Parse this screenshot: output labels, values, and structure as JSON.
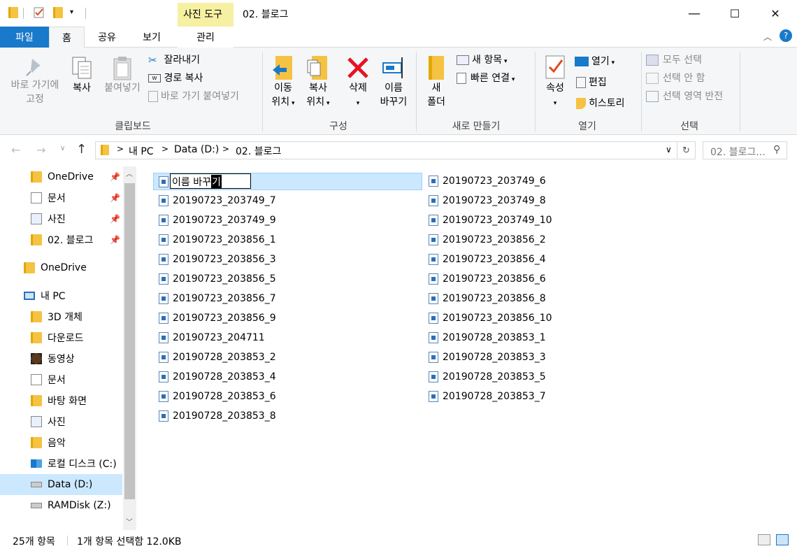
{
  "titlebar": {
    "tool_tab": "사진 도구",
    "window_title": "02. 블로그",
    "minimize": "—",
    "maximize": "☐",
    "close": "✕"
  },
  "tabs": {
    "file": "파일",
    "home": "홈",
    "share": "공유",
    "view": "보기",
    "manage": "관리"
  },
  "ribbon": {
    "clipboard": {
      "pin_line1": "바로 가기에",
      "pin_line2": "고정",
      "copy": "복사",
      "paste": "붙여넣기",
      "cut": "잘라내기",
      "copy_path": "경로 복사",
      "paste_shortcut": "바로 가기 붙여넣기",
      "group": "클립보드"
    },
    "organize": {
      "move_line1": "이동",
      "move_line2": "위치",
      "copyto_line1": "복사",
      "copyto_line2": "위치",
      "delete": "삭제",
      "rename_line1": "이름",
      "rename_line2": "바꾸기",
      "group": "구성"
    },
    "new": {
      "folder_line1": "새",
      "folder_line2": "폴더",
      "new_item": "새 항목",
      "easy_access": "빠른 연결",
      "group": "새로 만들기"
    },
    "open": {
      "properties": "속성",
      "open": "열기",
      "edit": "편집",
      "history": "히스토리",
      "group": "열기"
    },
    "select": {
      "select_all": "모두 선택",
      "select_none": "선택 안 함",
      "invert": "선택 영역 반전",
      "group": "선택"
    }
  },
  "address": {
    "crumbs": [
      "내 PC",
      "Data (D:)",
      "02. 블로그"
    ],
    "search_placeholder": "02. 블로그..."
  },
  "nav": {
    "quick": [
      {
        "label": "OneDrive"
      },
      {
        "label": "문서"
      },
      {
        "label": "사진"
      },
      {
        "label": "02. 블로그"
      }
    ],
    "onedrive": "OneDrive",
    "mypc": "내 PC",
    "pc_items": [
      {
        "label": "3D 개체"
      },
      {
        "label": "다운로드"
      },
      {
        "label": "동영상"
      },
      {
        "label": "문서"
      },
      {
        "label": "바탕 화면"
      },
      {
        "label": "사진"
      },
      {
        "label": "음악"
      },
      {
        "label": "로컬 디스크 (C:)"
      },
      {
        "label": "Data (D:)"
      },
      {
        "label": "RAMDisk (Z:)"
      }
    ]
  },
  "files": {
    "rename_text": "이름 바꾸",
    "rename_caret": "기",
    "col1": [
      "20190723_203749_7",
      "20190723_203749_9",
      "20190723_203856_1",
      "20190723_203856_3",
      "20190723_203856_5",
      "20190723_203856_7",
      "20190723_203856_9",
      "20190723_204711",
      "20190728_203853_2",
      "20190728_203853_4",
      "20190728_203853_6",
      "20190728_203853_8"
    ],
    "col2": [
      "20190723_203749_6",
      "20190723_203749_8",
      "20190723_203749_10",
      "20190723_203856_2",
      "20190723_203856_4",
      "20190723_203856_6",
      "20190723_203856_8",
      "20190723_203856_10",
      "20190728_203853_1",
      "20190728_203853_3",
      "20190728_203853_5",
      "20190728_203853_7"
    ]
  },
  "status": {
    "count": "25개 항목",
    "selection": "1개 항목 선택함 12.0KB"
  },
  "colors": {
    "accent": "#1979ca",
    "selection": "#cce8ff",
    "tool_tab": "#f6f0a2",
    "folder": "#f5c242",
    "delete_red": "#e81123"
  }
}
